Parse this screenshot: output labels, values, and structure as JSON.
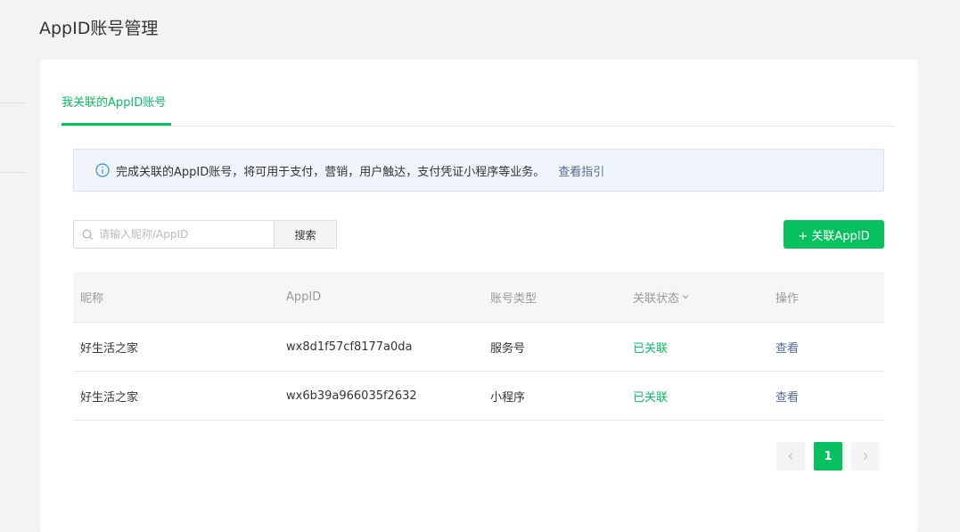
{
  "page": {
    "title": "AppID账号管理"
  },
  "tabs": [
    {
      "label": "我关联的AppID账号",
      "active": true
    }
  ],
  "notice": {
    "icon": "info-icon",
    "text": "完成关联的AppID账号，将可用于支付，营销，用户触达，支付凭证小程序等业务。",
    "link": "查看指引"
  },
  "search": {
    "placeholder": "请输入昵称/AppID",
    "value": "",
    "button_label": "搜索"
  },
  "add_button": {
    "label": "+ 关联AppID"
  },
  "table": {
    "headers": [
      "昵称",
      "AppID",
      "账号类型",
      "关联状态",
      "操作"
    ],
    "rows": [
      {
        "nickname": "好生活之家",
        "appid": "wx8d1f57cf8177a0da",
        "type": "服务号",
        "status": "已关联",
        "action": "查看"
      },
      {
        "nickname": "好生活之家",
        "appid": "wx6b39a966035f2632",
        "type": "小程序",
        "status": "已关联",
        "action": "查看"
      }
    ]
  },
  "pagination": {
    "current_page": "1"
  },
  "colors": {
    "accent_green": "#07c160",
    "link_blue": "#576b95",
    "notice_bg": "#eff5fb"
  }
}
